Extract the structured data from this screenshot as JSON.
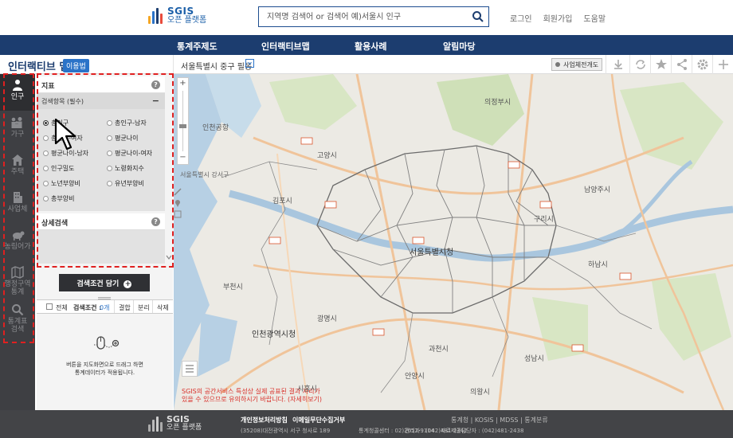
{
  "header": {
    "logo_main": "SGIS",
    "logo_sub": "오픈 플랫폼",
    "search_placeholder": "지역명 검색어 or 검색어 예)서울시 인구",
    "links": [
      "로그인",
      "회원가입",
      "도움말"
    ]
  },
  "nav": {
    "items": [
      "통계주제도",
      "인터랙티브맵",
      "활용사례",
      "알림마당"
    ]
  },
  "titlebar": {
    "title": "인터랙티브 맵",
    "badge": "이용법",
    "location": "서울특별시 중구 필동",
    "business_btn": "사업체전개도"
  },
  "leftbar": {
    "items": [
      {
        "label": "인구",
        "icon": "person-icon",
        "active": true
      },
      {
        "label": "가구",
        "icon": "family-icon"
      },
      {
        "label": "주택",
        "icon": "house-icon"
      },
      {
        "label": "사업체",
        "icon": "building-icon"
      },
      {
        "label": "농림어가",
        "icon": "cow-icon"
      },
      {
        "label1": "행정구역",
        "label2": "통계",
        "icon": "map-icon"
      },
      {
        "label1": "통계표",
        "label2": "검색",
        "icon": "search-icon"
      }
    ]
  },
  "panel": {
    "indicator_header": "지표",
    "category_header": "검색항목 (필수)",
    "options": [
      "총인구",
      "총인구-남자",
      "총인구-여자",
      "평균나이",
      "평균나이-남자",
      "평균나이-여자",
      "인구밀도",
      "노령화지수",
      "노년부양비",
      "유년부양비",
      "총부양비"
    ],
    "detail_header": "상세검색",
    "cond_button": "검색조건 담기",
    "filter": {
      "all": "전체",
      "cond_label": "검색조건 : ",
      "cond_count": "0개",
      "merge": "결합",
      "split": "분리",
      "delete": "삭제"
    },
    "empty_line1": "버튼을 지도화면으로 드래그 하면",
    "empty_line2": "통계데이터가 적용됩니다."
  },
  "map": {
    "scale_label": "서울특별시 강서구",
    "notice_line1": "SGIS의 공간서비스 특성상 실제 공표된 결과 자리가",
    "notice_line2": "있을 수 있으므로 유의하시기 바랍니다. (자세히보기)",
    "places": [
      "서울특별시청",
      "인천광역시청",
      "김포시",
      "고양시",
      "의정부시",
      "구리시",
      "남양주시",
      "하남시",
      "광명시",
      "과천시",
      "성남시",
      "안양시",
      "부천시",
      "시흥시",
      "의왕시",
      "인천공항"
    ],
    "colors": {
      "land": "#eceae4",
      "water": "#b7d0e4",
      "highway": "#f0c49a",
      "green": "#cfe0b8",
      "boundary": "#6b6b6b"
    }
  },
  "footer": {
    "logo_main": "SGIS",
    "logo_sub": "오픈 플랫폼",
    "privacy": "개인정보처리방침",
    "email": "이메일무단수집거부",
    "address": "(35208)대전광역시 서구 청사로 189",
    "phone1": "통계청콜센터 : 02)2012-9114",
    "phone2": "관리자 : (042)481-2342",
    "phone3": "자료제공담당자 : (042)481-2438",
    "right_links": "통계청 | KOSIS | MDSS | 통계분류"
  }
}
